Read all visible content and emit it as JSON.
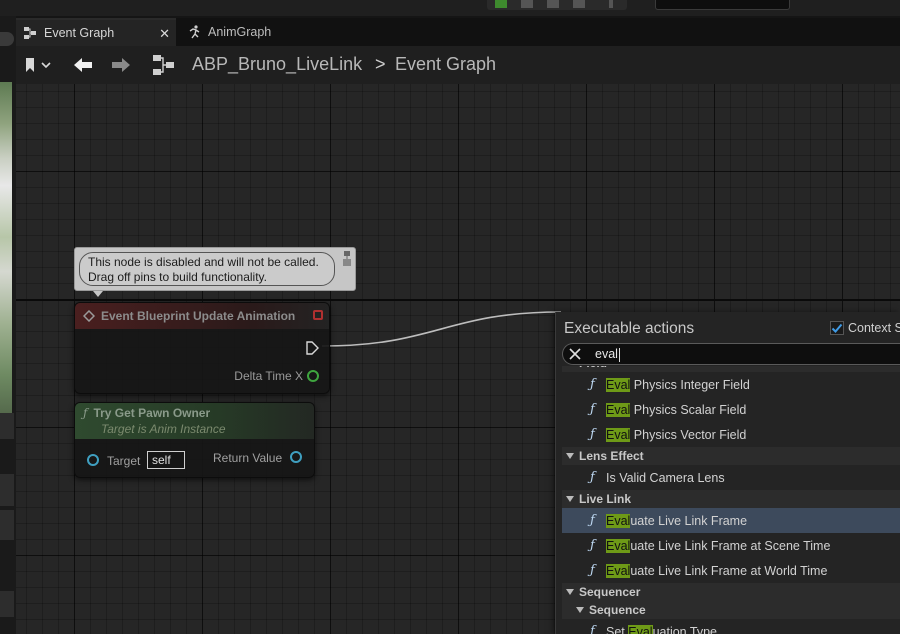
{
  "tabs": [
    {
      "label": "Event Graph",
      "icon": "event-graph-icon",
      "closable": true
    },
    {
      "label": "AnimGraph",
      "icon": "running-man-icon",
      "closable": false
    }
  ],
  "breadcrumb": {
    "asset": "ABP_Bruno_LiveLink",
    "separator": ">",
    "graph": "Event Graph"
  },
  "comment": {
    "line1": "This node is disabled and will not be called.",
    "line2": "Drag off pins to build functionality."
  },
  "nodes": {
    "event": {
      "title": "Event Blueprint Update Animation",
      "pin_delta": "Delta Time X"
    },
    "pawn": {
      "title": "Try Get Pawn Owner",
      "subtitle": "Target is Anim Instance",
      "pin_target": "Target",
      "target_value": "self",
      "pin_return": "Return Value"
    }
  },
  "menu": {
    "title": "Executable actions",
    "context_label": "Context S",
    "context_checked": true,
    "search_value": "eval",
    "highlight_color": "#6e9a17",
    "items": [
      {
        "type": "cat",
        "label": "Field",
        "cut": true
      },
      {
        "type": "fn",
        "hl": "Eval",
        "rest": " Physics Integer Field"
      },
      {
        "type": "fn",
        "hl": "Eval",
        "rest": " Physics Scalar Field"
      },
      {
        "type": "fn",
        "hl": "Eval",
        "rest": " Physics Vector Field"
      },
      {
        "type": "cat",
        "label": "Lens Effect"
      },
      {
        "type": "fn",
        "hl": "",
        "rest": "Is Valid Camera Lens"
      },
      {
        "type": "cat",
        "label": "Live Link"
      },
      {
        "type": "fn",
        "hl": "Eval",
        "rest": "uate Live Link Frame",
        "selected": true
      },
      {
        "type": "fn",
        "hl": "Eval",
        "rest": "uate Live Link Frame at Scene Time"
      },
      {
        "type": "fn",
        "hl": "Eval",
        "rest": "uate Live Link Frame at World Time"
      },
      {
        "type": "cat",
        "label": "Sequencer"
      },
      {
        "type": "subcat",
        "label": "Sequence"
      },
      {
        "type": "fn",
        "pre": "Set ",
        "hl": "Eval",
        "rest": "uation Type",
        "cut": true
      }
    ]
  }
}
